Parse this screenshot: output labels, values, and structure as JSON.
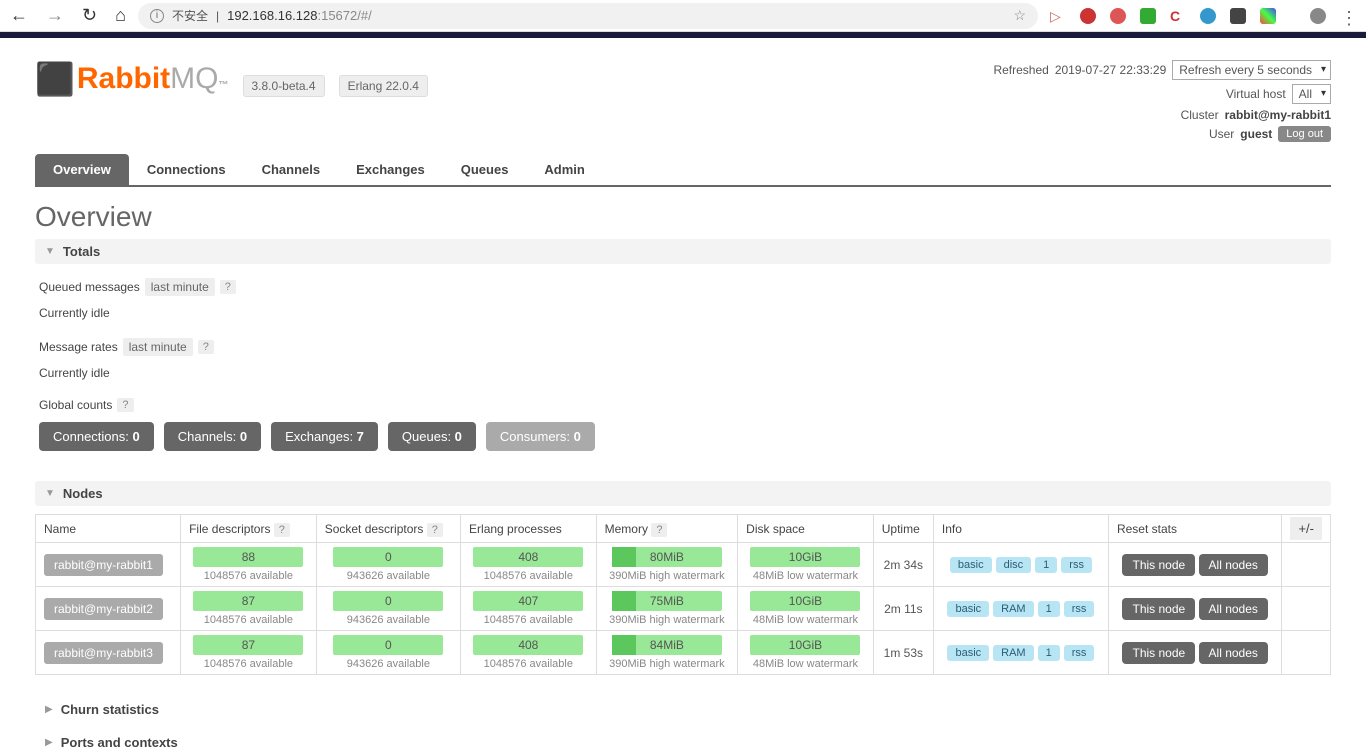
{
  "browser": {
    "insecure_label": "不安全",
    "url_host": "192.168.16.128",
    "url_port": ":15672/#/"
  },
  "logo": {
    "rabbit": "Rabbit",
    "mq": "MQ"
  },
  "versions": {
    "rabbit": "3.8.0-beta.4",
    "erlang": "Erlang 22.0.4"
  },
  "status": {
    "refreshed_label": "Refreshed",
    "refreshed_at": "2019-07-27 22:33:29",
    "refresh_option": "Refresh every 5 seconds",
    "vhost_label": "Virtual host",
    "vhost_value": "All",
    "cluster_label": "Cluster",
    "cluster_value": "rabbit@my-rabbit1",
    "user_label": "User",
    "user_value": "guest",
    "logout": "Log out"
  },
  "tabs": [
    "Overview",
    "Connections",
    "Channels",
    "Exchanges",
    "Queues",
    "Admin"
  ],
  "page_title": "Overview",
  "totals": {
    "header": "Totals",
    "queued_label": "Queued messages",
    "last_minute": "last minute",
    "idle1": "Currently idle",
    "rates_label": "Message rates",
    "idle2": "Currently idle",
    "global_label": "Global counts",
    "help": "?"
  },
  "counts": [
    {
      "label": "Connections:",
      "value": "0"
    },
    {
      "label": "Channels:",
      "value": "0"
    },
    {
      "label": "Exchanges:",
      "value": "7"
    },
    {
      "label": "Queues:",
      "value": "0"
    },
    {
      "label": "Consumers:",
      "value": "0"
    }
  ],
  "nodes_header": "Nodes",
  "nodes_columns": {
    "name": "Name",
    "fd": "File descriptors",
    "sd": "Socket descriptors",
    "ep": "Erlang processes",
    "mem": "Memory",
    "disk": "Disk space",
    "uptime": "Uptime",
    "info": "Info",
    "reset": "Reset stats",
    "plusminus": "+/-"
  },
  "nodes": [
    {
      "name": "rabbit@my-rabbit1",
      "fd": "88",
      "fd_sub": "1048576 available",
      "sd": "0",
      "sd_sub": "943626 available",
      "ep": "408",
      "ep_sub": "1048576 available",
      "mem": "80MiB",
      "mem_sub": "390MiB high watermark",
      "disk": "10GiB",
      "disk_sub": "48MiB low watermark",
      "uptime": "2m 34s",
      "info": [
        "basic",
        "disc",
        "1",
        "rss"
      ],
      "reset": [
        "This node",
        "All nodes"
      ]
    },
    {
      "name": "rabbit@my-rabbit2",
      "fd": "87",
      "fd_sub": "1048576 available",
      "sd": "0",
      "sd_sub": "943626 available",
      "ep": "407",
      "ep_sub": "1048576 available",
      "mem": "75MiB",
      "mem_sub": "390MiB high watermark",
      "disk": "10GiB",
      "disk_sub": "48MiB low watermark",
      "uptime": "2m 11s",
      "info": [
        "basic",
        "RAM",
        "1",
        "rss"
      ],
      "reset": [
        "This node",
        "All nodes"
      ]
    },
    {
      "name": "rabbit@my-rabbit3",
      "fd": "87",
      "fd_sub": "1048576 available",
      "sd": "0",
      "sd_sub": "943626 available",
      "ep": "408",
      "ep_sub": "1048576 available",
      "mem": "84MiB",
      "mem_sub": "390MiB high watermark",
      "disk": "10GiB",
      "disk_sub": "48MiB low watermark",
      "uptime": "1m 53s",
      "info": [
        "basic",
        "RAM",
        "1",
        "rss"
      ],
      "reset": [
        "This node",
        "All nodes"
      ]
    }
  ],
  "churn_header": "Churn statistics",
  "ports_header": "Ports and contexts"
}
